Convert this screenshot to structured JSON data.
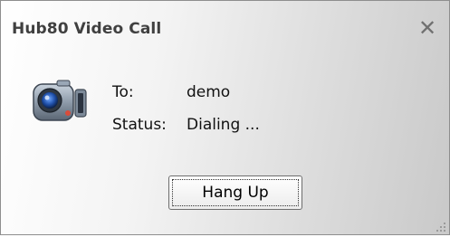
{
  "dialog": {
    "title": "Hub80 Video Call",
    "close_glyph": "✕"
  },
  "call": {
    "to_label": "To:",
    "to_value": "demo",
    "status_label": "Status:",
    "status_value": "Dialing ..."
  },
  "actions": {
    "hangup_label": "Hang Up"
  },
  "icons": {
    "camera": "video-camera-icon",
    "close": "close-icon",
    "resize": "resize-grip-icon"
  }
}
